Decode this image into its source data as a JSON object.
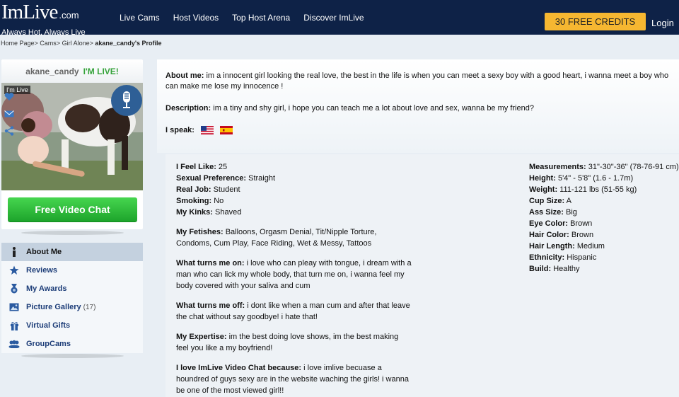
{
  "header": {
    "logo_main": "ImLive",
    "logo_com": ".com",
    "logo_tagline": "Always Hot, Always Live",
    "nav": [
      "Live Cams",
      "Host Videos",
      "Top Host Arena",
      "Discover ImLive"
    ],
    "credits_label": "30 FREE CREDITS",
    "login_label": "Login"
  },
  "breadcrumb": {
    "items": [
      "Home Page",
      "Cams",
      "Girl Alone"
    ],
    "current": "akane_candy's Profile"
  },
  "profile_card": {
    "username": "akane_candy",
    "live_label": "I'M LIVE!",
    "live_tag": "I'm Live",
    "video_button": "Free Video Chat"
  },
  "menu": {
    "items": [
      {
        "label": "About Me",
        "icon": "info-icon"
      },
      {
        "label": "Reviews",
        "icon": "star-icon"
      },
      {
        "label": "My Awards",
        "icon": "medal-icon"
      },
      {
        "label": "Picture Gallery",
        "count": "(17)",
        "icon": "picture-icon"
      },
      {
        "label": "Virtual Gifts",
        "icon": "gift-icon"
      },
      {
        "label": "GroupCams",
        "icon": "group-icon"
      }
    ]
  },
  "about": {
    "about_label": "About me:",
    "about_text": "im a innocent girl looking the real love, the best in the life is when you can meet a sexy boy with a good heart, i wanna meet a boy who can make me lose my innocence !",
    "desc_label": "Description:",
    "desc_text": "im a tiny and shy girl, i hope you can teach me a lot about love and sex, wanna be my friend?",
    "speak_label": "I speak:",
    "languages": [
      "us-flag-icon",
      "spain-flag-icon"
    ]
  },
  "details_left": {
    "feel_like_label": "I Feel Like:",
    "feel_like": "25",
    "sexual_pref_label": "Sexual Preference:",
    "sexual_pref": "Straight",
    "job_label": "Real Job:",
    "job": "Student",
    "smoking_label": "Smoking:",
    "smoking": "No",
    "kinks_label": "My Kinks:",
    "kinks": "Shaved",
    "fetishes_label": "My Fetishes:",
    "fetishes": "Balloons, Orgasm Denial, Tit/Nipple Torture, Condoms, Cum Play, Face Riding, Wet & Messy, Tattoos",
    "turn_on_label": "What turns me on:",
    "turn_on": "i love who can pleay with tongue, i dream with a man who can lick my whole body, that turn me on, i wanna feel my body covered with your saliva and cum",
    "turn_off_label": "What turns me off:",
    "turn_off": "i dont like when a man cum and after that leave the chat without say goodbye! i hate that!",
    "expertise_label": "My Expertise:",
    "expertise": "im the best doing love shows, im the best making feel you like a my boyfriend!",
    "love_label": "I love ImLive Video Chat because:",
    "love": "i love imlive becuase a houndred of guys sexy are in the website waching the girls! i wanna be one of the most viewed girl!!"
  },
  "details_right": {
    "measurements_label": "Measurements:",
    "measurements": "31\"-30\"-36\" (78-76-91 cm)",
    "height_label": "Height:",
    "height": "5'4\" - 5'8\" (1.6 - 1.7m)",
    "weight_label": "Weight:",
    "weight": "111-121 lbs (51-55 kg)",
    "cup_label": "Cup Size:",
    "cup": "A",
    "ass_label": "Ass Size:",
    "ass": "Big",
    "eye_label": "Eye Color:",
    "eye": "Brown",
    "hair_label": "Hair Color:",
    "hair": "Brown",
    "hair_len_label": "Hair Length:",
    "hair_len": "Medium",
    "ethnicity_label": "Ethnicity:",
    "ethnicity": "Hispanic",
    "build_label": "Build:",
    "build": "Healthy"
  }
}
